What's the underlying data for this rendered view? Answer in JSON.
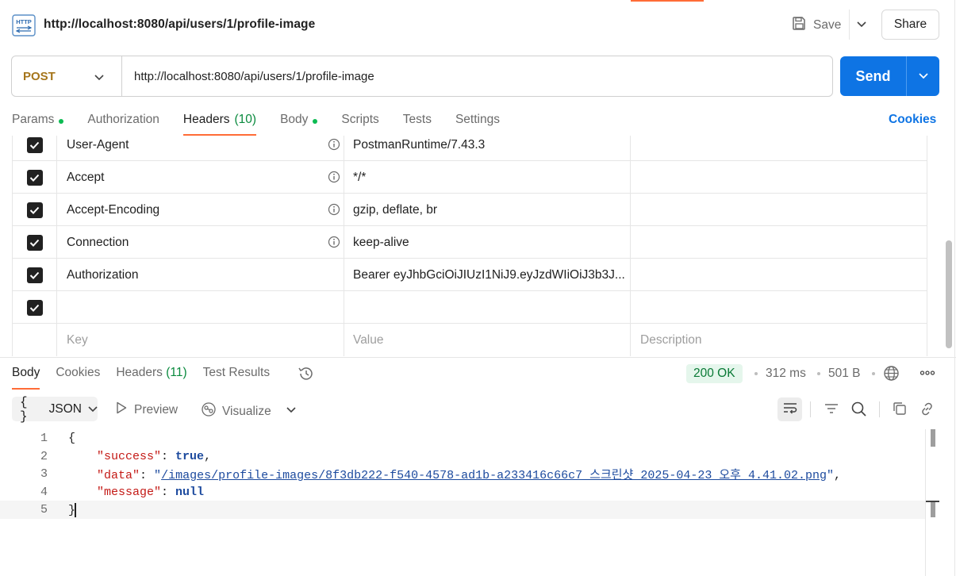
{
  "request": {
    "title": "http://localhost:8080/api/users/1/profile-image",
    "method": "POST",
    "url": "http://localhost:8080/api/users/1/profile-image",
    "save_label": "Save",
    "share_label": "Share",
    "send_label": "Send"
  },
  "request_tabs": [
    {
      "label": "Params",
      "dot": true
    },
    {
      "label": "Authorization"
    },
    {
      "label": "Headers",
      "count": "(10)",
      "active": true
    },
    {
      "label": "Body",
      "dot": true
    },
    {
      "label": "Scripts"
    },
    {
      "label": "Tests"
    },
    {
      "label": "Settings"
    }
  ],
  "cookies_label": "Cookies",
  "headers": [
    {
      "key": "User-Agent",
      "value": "PostmanRuntime/7.43.3",
      "info": true
    },
    {
      "key": "Accept",
      "value": "*/*",
      "info": true
    },
    {
      "key": "Accept-Encoding",
      "value": "gzip, deflate, br",
      "info": true
    },
    {
      "key": "Connection",
      "value": "keep-alive",
      "info": true
    },
    {
      "key": "Authorization",
      "value": "Bearer eyJhbGciOiJIUzI1NiJ9.eyJzdWIiOiJ3b3J...",
      "info": false
    },
    {
      "key": "",
      "value": "",
      "info": false
    }
  ],
  "header_placeholders": {
    "key": "Key",
    "value": "Value",
    "description": "Description"
  },
  "response": {
    "tabs": [
      {
        "label": "Body",
        "active": true
      },
      {
        "label": "Cookies"
      },
      {
        "label": "Headers",
        "count": "(11)"
      },
      {
        "label": "Test Results"
      }
    ],
    "status": "200 OK",
    "time": "312 ms",
    "size": "501 B",
    "format": "JSON",
    "preview_label": "Preview",
    "visualize_label": "Visualize",
    "lines": [
      "1",
      "2",
      "3",
      "4",
      "5"
    ],
    "json": {
      "open": "{",
      "success_key": "\"success\"",
      "success_val": "true",
      "data_key": "\"data\"",
      "data_val": "/images/profile-images/8f3db222-f540-4578-ad1b-a233416c66c7_스크린샷 2025-04-23 오후 4.41.02.png",
      "message_key": "\"message\"",
      "message_val": "null",
      "close": "}"
    }
  },
  "colors": {
    "accent": "#ff6c37",
    "send": "#0e74e4",
    "method": "#a5751b",
    "status_bg": "#e5f6ec",
    "status_fg": "#0a7a36"
  },
  "icons": {
    "http": "http-icon",
    "save": "save-icon",
    "history": "history-icon",
    "globe": "globe-icon",
    "more": "more-icon",
    "wrap": "wrap-icon",
    "filter": "filter-icon",
    "search": "search-icon",
    "copy": "copy-icon",
    "link": "link-icon"
  }
}
